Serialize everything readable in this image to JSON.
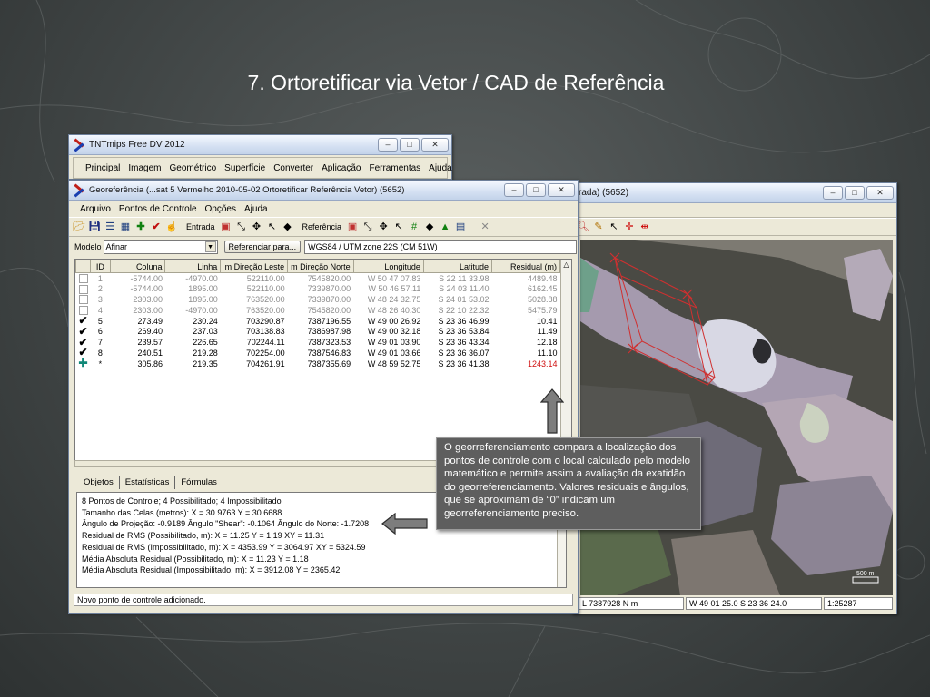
{
  "slide_title": "7. Ortoretificar via Vetor / CAD de Referência",
  "main_window": {
    "title": "TNTmips Free DV 2012",
    "menu": [
      "Principal",
      "Imagem",
      "Geométrico",
      "Superfície",
      "Converter",
      "Aplicação",
      "Ferramentas",
      "Ajuda"
    ]
  },
  "ref_window": {
    "title_visible": "rada) (5652)",
    "status": {
      "northing": "L 7387928 N m",
      "latlon": "W 49 01 25.0  S 23 36 24.0",
      "scale": "1:25287"
    },
    "scale_bar": "500 m"
  },
  "georef_window": {
    "title": "Georeferência (...sat 5 Vermelho 2010-05-02 Ortoretificar Referência Vetor) (5652)",
    "menu": [
      "Arquivo",
      "Pontos de Controle",
      "Opções",
      "Ajuda"
    ],
    "toolbar": {
      "entrada_label": "Entrada",
      "referencia_label": "Referência"
    },
    "model_label": "Modelo",
    "model_value": "Afinar",
    "referenciar_button": "Referenciar para...",
    "crs_value": "WGS84 / UTM zone 22S (CM 51W)",
    "table_headers": [
      "",
      "ID",
      "Coluna",
      "Linha",
      "m Direção Leste",
      "m Direção Norte",
      "Longitude",
      "Latitude",
      "Residual (m)"
    ],
    "rows": [
      {
        "mark": "box",
        "id": "1",
        "col": "-5744.00",
        "lin": "-4970.00",
        "east": "522110.00",
        "north": "7545820.00",
        "lon": "W 50 47 07.83",
        "lat": "S 22 11 33.98",
        "res": "4489.48",
        "state": "inactive"
      },
      {
        "mark": "box",
        "id": "2",
        "col": "-5744.00",
        "lin": "1895.00",
        "east": "522110.00",
        "north": "7339870.00",
        "lon": "W 50 46 57.11",
        "lat": "S 24 03 11.40",
        "res": "6162.45",
        "state": "inactive"
      },
      {
        "mark": "box",
        "id": "3",
        "col": "2303.00",
        "lin": "1895.00",
        "east": "763520.00",
        "north": "7339870.00",
        "lon": "W 48 24 32.75",
        "lat": "S 24 01 53.02",
        "res": "5028.88",
        "state": "inactive"
      },
      {
        "mark": "box",
        "id": "4",
        "col": "2303.00",
        "lin": "-4970.00",
        "east": "763520.00",
        "north": "7545820.00",
        "lon": "W 48 26 40.30",
        "lat": "S 22 10 22.32",
        "res": "5475.79",
        "state": "inactive"
      },
      {
        "mark": "check",
        "id": "5",
        "col": "273.49",
        "lin": "230.24",
        "east": "703290.87",
        "north": "7387196.55",
        "lon": "W 49 00 26.92",
        "lat": "S 23 36 46.99",
        "res": "10.41",
        "state": "active"
      },
      {
        "mark": "check",
        "id": "6",
        "col": "269.40",
        "lin": "237.03",
        "east": "703138.83",
        "north": "7386987.98",
        "lon": "W 49 00 32.18",
        "lat": "S 23 36 53.84",
        "res": "11.49",
        "state": "active"
      },
      {
        "mark": "check",
        "id": "7",
        "col": "239.57",
        "lin": "226.65",
        "east": "702244.11",
        "north": "7387323.53",
        "lon": "W 49 01 03.90",
        "lat": "S 23 36 43.34",
        "res": "12.18",
        "state": "active"
      },
      {
        "mark": "check",
        "id": "8",
        "col": "240.51",
        "lin": "219.28",
        "east": "702254.00",
        "north": "7387546.83",
        "lon": "W 49 01 03.66",
        "lat": "S 23 36 36.07",
        "res": "11.10",
        "state": "active"
      },
      {
        "mark": "plus",
        "id": "*",
        "col": "305.86",
        "lin": "219.35",
        "east": "704261.91",
        "north": "7387355.69",
        "lon": "W 48 59 52.75",
        "lat": "S 23 36 41.38",
        "res": "1243.14",
        "state": "active"
      }
    ],
    "tabs": [
      "Objetos",
      "Estatísticas",
      "Fórmulas"
    ],
    "info_lines": [
      "8 Pontos de Controle;  4 Possibilitado;  4 Impossibilitado",
      "Tamanho das Celas (metros):  X = 30.9763  Y = 30.6688",
      "Ângulo de Projeção: -0.9189  Ângulo \"Shear\": -0.1064  Ângulo do Norte: -1.7208",
      "Residual de RMS (Possibilitado, m):  X = 11.25  Y = 1.19  XY = 11.31",
      "Residual de RMS (Impossibilitado, m):  X = 4353.99  Y = 3064.97  XY = 5324.59",
      "Média Absoluta Residual (Possibilitado, m):  X = 11.23  Y = 1.18",
      "Média Absoluta Residual (Impossibilitado, m):  X = 3912.08  Y = 2365.42"
    ],
    "status": "Novo ponto de controle adicionado."
  },
  "callout_text": "O georreferenciamento compara a localização dos pontos de controle com o local calculado pelo modelo matemático e permite assim a avaliação da exatidão do georreferenciamento. Valores residuais e ângulos, que se aproximam de “0” indicam um georreferenciamento preciso.",
  "colors": {
    "background": "#424747",
    "window_face": "#ece9d8",
    "residual_highlight": "#d01010",
    "callout": "#5e5e5e"
  }
}
